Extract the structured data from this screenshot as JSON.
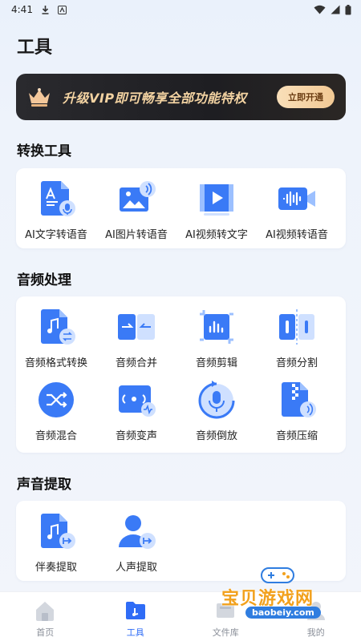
{
  "status": {
    "time": "4:41"
  },
  "page": {
    "title": "工具"
  },
  "vip": {
    "text": "升级VIP即可畅享全部功能特权",
    "button": "立即开通"
  },
  "sections": [
    {
      "title": "转换工具",
      "items": [
        {
          "label": "AI文字转语音",
          "icon": "text-to-speech-icon"
        },
        {
          "label": "AI图片转语音",
          "icon": "image-to-speech-icon"
        },
        {
          "label": "AI视频转文字",
          "icon": "video-to-text-icon"
        },
        {
          "label": "AI视频转语音",
          "icon": "video-to-speech-icon"
        }
      ]
    },
    {
      "title": "音频处理",
      "items": [
        {
          "label": "音频格式转换",
          "icon": "audio-format-convert-icon"
        },
        {
          "label": "音频合并",
          "icon": "audio-merge-icon"
        },
        {
          "label": "音频剪辑",
          "icon": "audio-crop-icon"
        },
        {
          "label": "音频分割",
          "icon": "audio-split-icon"
        },
        {
          "label": "音频混合",
          "icon": "audio-mix-icon"
        },
        {
          "label": "音频变声",
          "icon": "voice-change-icon"
        },
        {
          "label": "音频倒放",
          "icon": "audio-reverse-icon"
        },
        {
          "label": "音频压缩",
          "icon": "audio-compress-icon"
        }
      ]
    },
    {
      "title": "声音提取",
      "items": [
        {
          "label": "伴奏提取",
          "icon": "accompaniment-extract-icon"
        },
        {
          "label": "人声提取",
          "icon": "vocal-extract-icon"
        }
      ]
    }
  ],
  "nav": [
    {
      "label": "首页",
      "icon": "home-icon",
      "active": false
    },
    {
      "label": "工具",
      "icon": "tools-folder-icon",
      "active": true
    },
    {
      "label": "文件库",
      "icon": "file-library-icon",
      "active": false
    },
    {
      "label": "我的",
      "icon": "profile-icon",
      "active": false
    }
  ],
  "watermark": {
    "text": "宝贝游戏网",
    "url": "baobeiy.com"
  },
  "colors": {
    "accent": "#2f6cf6",
    "icon_blue": "#3a7af6",
    "icon_light": "#cfe0ff",
    "vip_gold": "#f3d3a2"
  }
}
